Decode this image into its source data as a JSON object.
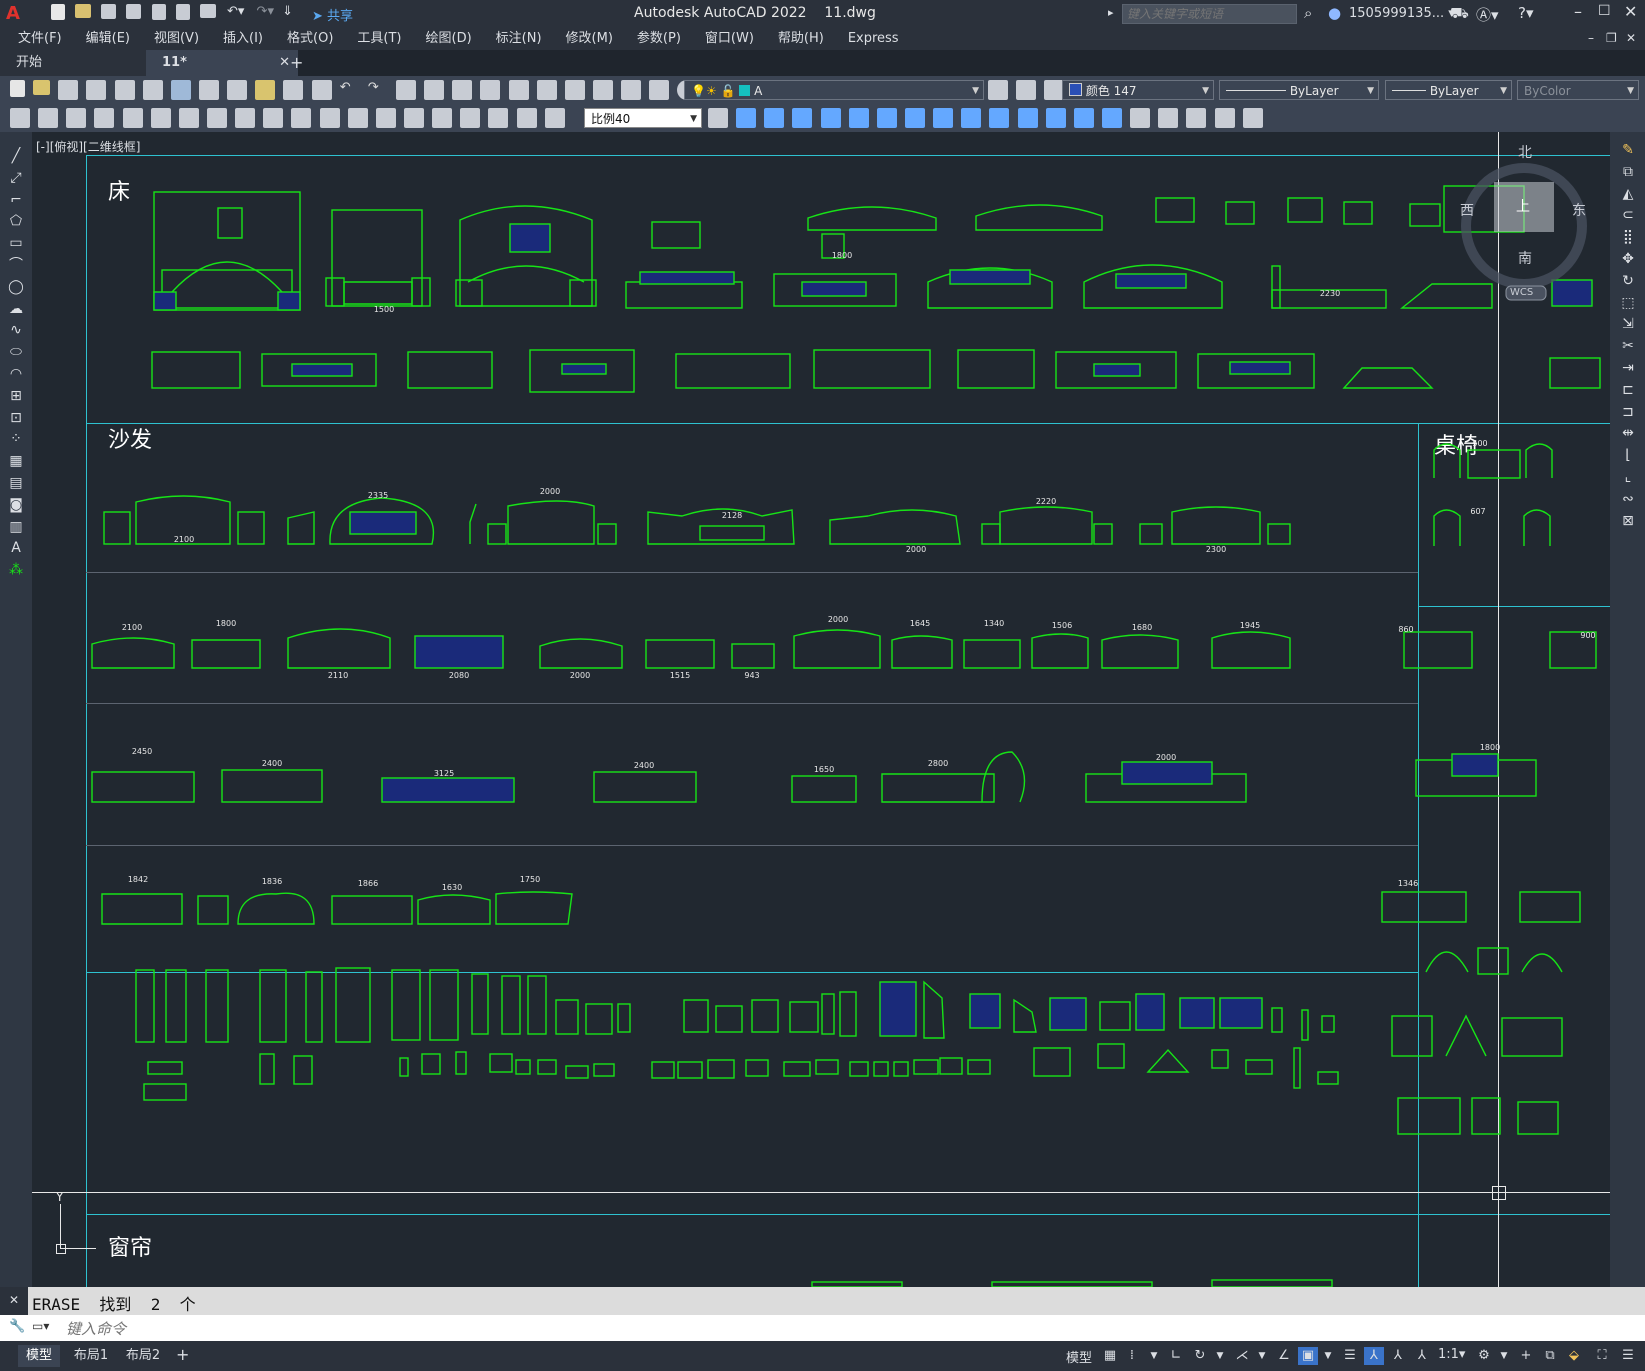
{
  "app": {
    "logo": "A",
    "title": "Autodesk AutoCAD 2022",
    "filename": "11.dwg",
    "share_label": "共享",
    "search_placeholder": "键入关键字或短语",
    "user": "1505999135...",
    "colors": {
      "accent_cyan": "#2ec2d0",
      "drawing_green": "#17e317",
      "drawing_blue": "#2a4fb6",
      "logo_red": "#e0322d"
    }
  },
  "menu": [
    "文件(F)",
    "编辑(E)",
    "视图(V)",
    "插入(I)",
    "格式(O)",
    "工具(T)",
    "绘图(D)",
    "标注(N)",
    "修改(M)",
    "参数(P)",
    "窗口(W)",
    "帮助(H)",
    "Express"
  ],
  "tabs": {
    "start": "开始",
    "current": "11*",
    "add": "+"
  },
  "properties": {
    "layer": "A",
    "color": "颜色 147",
    "linetype": "ByLayer",
    "lineweight": "ByLayer",
    "plotstyle": "ByColor",
    "annoscale": "比例40"
  },
  "viewport_label": "[-][俯视][二维线框]",
  "viewcube": {
    "north": "北",
    "south": "南",
    "east": "东",
    "west": "西",
    "top": "上",
    "wcs": "WCS"
  },
  "sections": {
    "bed": "床",
    "sofa": "沙发",
    "table_chair": "桌椅",
    "curtain": "窗帘"
  },
  "dims": {
    "sofa_row1": [
      "2100",
      "2335",
      "2000",
      "2128",
      "2000",
      "2220",
      "2300"
    ],
    "sofa_row2": [
      "2100",
      "1800",
      "2110",
      "2080",
      "2000",
      "1515",
      "943",
      "2000",
      "1645",
      "1340",
      "1506",
      "1680",
      "1945"
    ],
    "sofa_row3": [
      "2450",
      "2400",
      "3125",
      "2400",
      "1650",
      "2800",
      "2000"
    ],
    "sofa_row4": [
      "1842",
      "1836",
      "1866",
      "1630",
      "1750"
    ],
    "bed_row1": [
      "1500",
      "1800",
      "2230"
    ],
    "table": [
      "500",
      "607",
      "860",
      "900",
      "1800",
      "1346"
    ]
  },
  "command": {
    "history": "ERASE  找到  2  个",
    "placeholder": "键入命令"
  },
  "layout_tabs": [
    "模型",
    "布局1",
    "布局2",
    "+"
  ],
  "status": {
    "model": "模型",
    "scale": "1:1"
  }
}
